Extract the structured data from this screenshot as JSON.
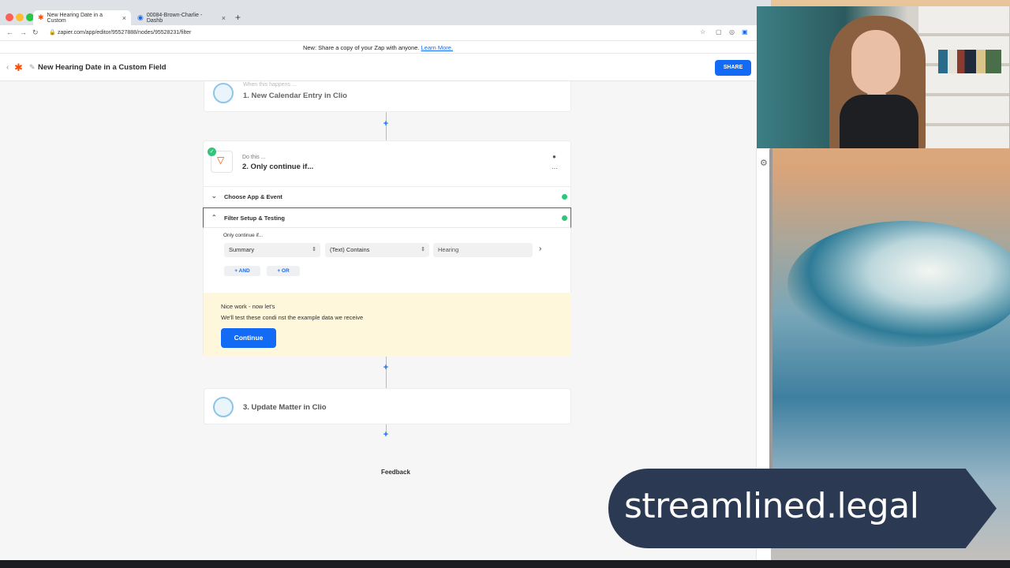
{
  "browser": {
    "tabs": [
      {
        "label": "New Hearing Date in a Custom",
        "active": true
      },
      {
        "label": "00084-Brown-Charlie - Dashb",
        "active": false
      }
    ],
    "url": "zapier.com/app/editor/95527888/nodes/95528231/filter"
  },
  "banner": {
    "text": "New: Share a copy of your Zap with anyone.",
    "link": "Learn More."
  },
  "zap": {
    "title": "New Hearing Date in a Custom Field",
    "share_label": "SHARE",
    "step1": {
      "label": "When this happens ...",
      "title": "1. New Calendar Entry in Clio"
    },
    "step2": {
      "label": "Do this ...",
      "title": "2. Only continue if...",
      "sections": [
        {
          "label": "Choose App & Event",
          "expanded": false
        },
        {
          "label": "Filter Setup & Testing",
          "expanded": true
        }
      ],
      "filter": {
        "intro": "Only continue if...",
        "field": "Summary",
        "condition": "(Text) Contains",
        "value": "Hearing",
        "and_label": "AND",
        "or_label": "OR"
      },
      "notice": {
        "line1": "Nice work - now let's",
        "line2": "We'll test these condi           nst the example data we receive",
        "continue_label": "Continue"
      }
    },
    "step3": {
      "title": "3. Update Matter in Clio"
    },
    "feedback_label": "Feedback"
  },
  "brand": {
    "text": "streamlined.legal"
  },
  "colors": {
    "accent": "#136bf5",
    "success": "#2fc67a",
    "zapier": "#ff4a00",
    "notice": "#fff7dc"
  }
}
